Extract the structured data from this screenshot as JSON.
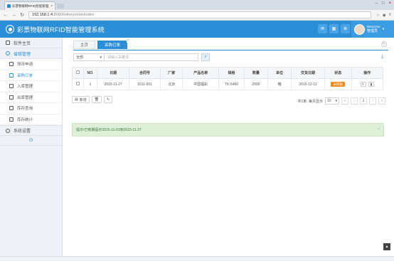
{
  "browser": {
    "tab_title": "彩票物联网RFID智能管理系统 — 采购订单",
    "url_host": "192.168.1.4",
    "url_path": ":8080/lottery/main/index"
  },
  "app": {
    "title": "彩票物联网RFID智能管理系统",
    "user_welcome": "Welcome",
    "user_name": "管理员",
    "accent": "#2b8fd8"
  },
  "sidebar": {
    "home": "软件主页",
    "group1": "省级管理",
    "items": [
      {
        "label": "领币申请",
        "icon": "doc-icon"
      },
      {
        "label": "采购订单",
        "icon": "doc-icon"
      },
      {
        "label": "入库管理",
        "icon": "doc-icon"
      },
      {
        "label": "出库管理",
        "icon": "doc-icon"
      },
      {
        "label": "库存查询",
        "icon": "doc-icon"
      },
      {
        "label": "库存统计",
        "icon": "doc-icon"
      }
    ],
    "group2": "系统设置"
  },
  "tabs": [
    {
      "label": "主页"
    },
    {
      "label": "采购订单"
    }
  ],
  "filter": {
    "select": "全部",
    "placeholder": "请输入关键词"
  },
  "table": {
    "headers": [
      "NO.",
      "日期",
      "合同号",
      "厂家",
      "产品名称",
      "规格",
      "数量",
      "单位",
      "交货日期",
      "状态",
      "操作"
    ],
    "rows": [
      {
        "no": "1",
        "date": "2015-11-27",
        "contract": "1511-001",
        "vendor": "北京",
        "product": "中国福彩",
        "spec": "TK-5460",
        "qty": "2000",
        "unit": "箱",
        "delivery": "2015-12-12",
        "status": "未审核"
      }
    ]
  },
  "toolbar": {
    "add": "新增"
  },
  "pager": {
    "summary": "共1条, 每页显示",
    "page_size": "10",
    "current": "1"
  },
  "alert": {
    "text": "提示!已到期提示2015-11-01到2015-11-27"
  }
}
